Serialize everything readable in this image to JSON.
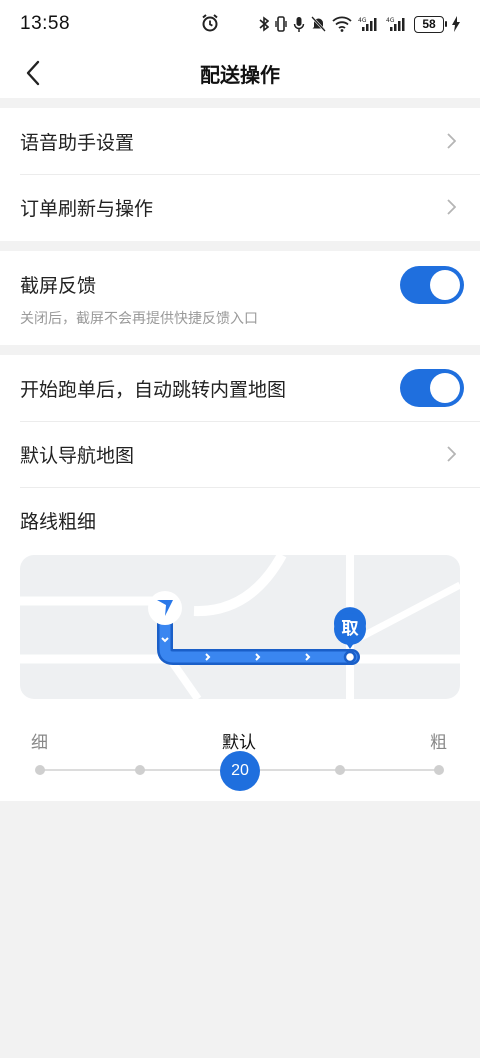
{
  "status_bar": {
    "time": "13:58",
    "battery": "58",
    "icons": [
      "alarm-icon",
      "bluetooth-icon",
      "vibrate-icon",
      "mic-icon",
      "mute-icon",
      "wifi-icon",
      "signal-4g-icon",
      "signal-4g-icon",
      "battery-icon",
      "charging-icon"
    ]
  },
  "nav": {
    "title": "配送操作"
  },
  "section1": {
    "items": [
      {
        "label": "语音助手设置"
      },
      {
        "label": "订单刷新与操作"
      }
    ]
  },
  "section2": {
    "screenshot_feedback": {
      "label": "截屏反馈",
      "enabled": true,
      "description": "关闭后，截屏不会再提供快捷反馈入口"
    }
  },
  "section3": {
    "auto_jump": {
      "label": "开始跑单后，自动跳转内置地图",
      "enabled": true
    },
    "default_nav": {
      "label": "默认导航地图"
    },
    "route_width": {
      "label": "路线粗细",
      "pickup_marker": "取",
      "slider": {
        "min_label": "细",
        "default_label": "默认",
        "max_label": "粗",
        "value": "20",
        "position_index": 2,
        "step_count": 5
      }
    }
  },
  "colors": {
    "accent": "#1f6fde",
    "background": "#f2f2f2"
  }
}
